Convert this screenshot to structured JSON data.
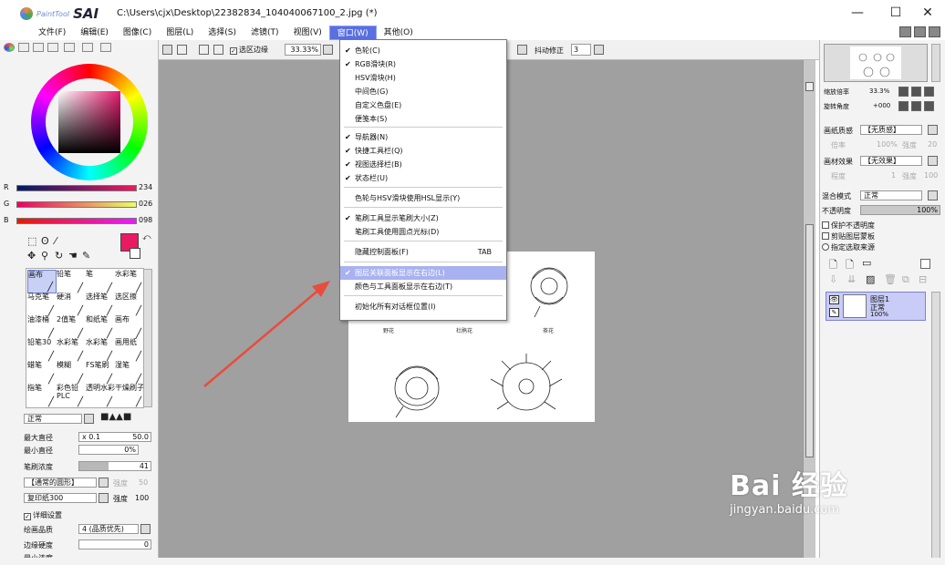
{
  "app": {
    "logo_small": "PaintTool",
    "logo_big": "SAI",
    "title": "C:\\Users\\cjx\\Desktop\\22382834_104040067100_2.jpg (*)"
  },
  "window_controls": {
    "minimize": "—",
    "maximize": "☐",
    "close": "✕"
  },
  "menubar": [
    {
      "label": "文件(F)"
    },
    {
      "label": "编辑(E)"
    },
    {
      "label": "图像(C)"
    },
    {
      "label": "图层(L)"
    },
    {
      "label": "选择(S)"
    },
    {
      "label": "滤镜(T)"
    },
    {
      "label": "视图(V)"
    },
    {
      "label": "窗口(W)",
      "active": true
    },
    {
      "label": "其他(O)"
    }
  ],
  "canvas_toolbar": {
    "selection_edge_label": "选区边缘",
    "zoom_value": "33.33%",
    "stabilizer_label": "抖动修正",
    "stabilizer_value": "3"
  },
  "window_menu": {
    "items": [
      {
        "label": "色轮(C)",
        "checked": true
      },
      {
        "label": "RGB滑块(R)",
        "checked": true
      },
      {
        "label": "HSV滑块(H)",
        "checked": false
      },
      {
        "label": "中间色(G)",
        "checked": false
      },
      {
        "label": "自定义色盘(E)",
        "checked": false
      },
      {
        "label": "便笺本(S)",
        "checked": false
      },
      {
        "label": "导航器(N)",
        "checked": true
      },
      {
        "label": "快捷工具栏(Q)",
        "checked": true
      },
      {
        "label": "视图选择栏(B)",
        "checked": true
      },
      {
        "label": "状态栏(U)",
        "checked": true
      },
      {
        "label": "色轮与HSV滑块使用HSL显示(Y)",
        "checked": false
      },
      {
        "label": "笔刷工具显示笔刷大小(Z)",
        "checked": true
      },
      {
        "label": "笔刷工具使用圆点光标(D)",
        "checked": false
      },
      {
        "label": "隐藏控制面板(F)",
        "checked": false,
        "shortcut": "TAB"
      },
      {
        "label": "图层关联面板显示在右边(L)",
        "checked": true,
        "highlighted": true
      },
      {
        "label": "颜色与工具面板显示在右边(T)",
        "checked": false
      },
      {
        "label": "初始化所有对话框位置(I)",
        "checked": false
      }
    ]
  },
  "color": {
    "r_label": "R",
    "r_value": "234",
    "g_label": "G",
    "g_value": "026",
    "b_label": "B",
    "b_value": "098",
    "primary_hex": "#ea1a62"
  },
  "brushes": [
    {
      "label": "画布"
    },
    {
      "label": "铅笔"
    },
    {
      "label": "笔"
    },
    {
      "label": "水彩笔"
    },
    {
      "label": "马克笔"
    },
    {
      "label": "硬消"
    },
    {
      "label": "选择笔"
    },
    {
      "label": "选区擦"
    },
    {
      "label": "油漆桶"
    },
    {
      "label": "2值笔"
    },
    {
      "label": "和纸笔"
    },
    {
      "label": "画布"
    },
    {
      "label": "铅笔30"
    },
    {
      "label": "水彩笔"
    },
    {
      "label": "水彩笔"
    },
    {
      "label": "画用纸"
    },
    {
      "label": "蜡笔"
    },
    {
      "label": "模糊"
    },
    {
      "label": "FS笔刷"
    },
    {
      "label": "湿笔"
    },
    {
      "label": "指笔"
    },
    {
      "label": "彩色铅PLC"
    },
    {
      "label": "透明水彩"
    },
    {
      "label": "干燥刷子"
    }
  ],
  "brush_settings": {
    "blend_mode": "正常",
    "max_size_label": "最大直径",
    "max_size_mult": "x 0.1",
    "max_size_value": "50.0",
    "min_size_label": "最小直径",
    "min_size_value": "0%",
    "density_label": "笔刷浓度",
    "density_value": "41",
    "shape_label": "【通常的圆形】",
    "shape_strength": "强度",
    "shape_strength_value": "50",
    "texture_label": "复印纸300",
    "texture_strength": "强度",
    "texture_strength_value": "100",
    "detail_label": "详细设置",
    "quality_label": "绘画品质",
    "quality_value": "4 (品质优先)",
    "edge_label": "边缘硬度",
    "edge_value": "0",
    "min_density_label": "最小浓度"
  },
  "right_panel": {
    "zoom_label": "缩放倍率",
    "zoom_value": "33.3%",
    "rotate_label": "旋转角度",
    "rotate_value": "+000",
    "paper_texture_label": "画纸质感",
    "paper_texture_value": "【无质感】",
    "paper_scale_label": "倍率",
    "paper_scale_value": "100%",
    "paper_strength_label": "强度",
    "paper_strength_value": "20",
    "paper_effect_label": "画材效果",
    "paper_effect_value": "【无效果】",
    "effect_width_label": "程度",
    "effect_width_value": "1",
    "effect_strength_label": "强度",
    "effect_strength_value": "100",
    "blend_label": "混合模式",
    "blend_value": "正常",
    "opacity_label": "不透明度",
    "opacity_value": "100%",
    "protect_label": "保护不透明度",
    "clip_label": "剪贴图层蒙板",
    "select_source_label": "指定选取来源",
    "layer_name": "图层1",
    "layer_mode": "正常",
    "layer_opacity": "100%"
  },
  "image_captions": {
    "left": "野花",
    "middle": "杜鹃花",
    "right": "茶花"
  },
  "watermark": {
    "big": "Bai 经验",
    "small": "jingyan.baidu.com"
  }
}
